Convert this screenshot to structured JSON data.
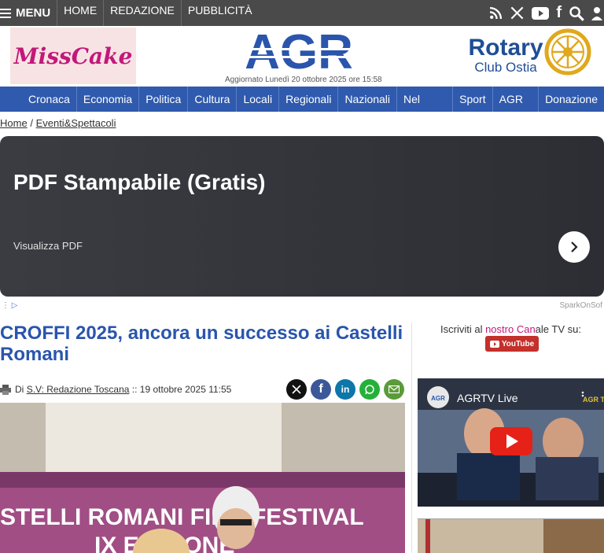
{
  "topbar": {
    "menu_label": "MENU",
    "links": [
      "HOME",
      "REDAZIONE",
      "PUBBLICITÀ"
    ],
    "icons": [
      "rss-icon",
      "x-icon",
      "youtube-icon",
      "facebook-icon",
      "search-icon",
      "user-icon"
    ]
  },
  "header": {
    "left_banner_text": "MissCake",
    "logo_text": "AGR",
    "updated_text": "Aggiornato Lunedì 20 ottobre 2025 ore 15:58",
    "rotary_line1": "Rotary",
    "rotary_line2": "Club Ostia"
  },
  "nav": {
    "items": [
      "Cronaca",
      "Economia",
      "Politica",
      "Cultura",
      "Locali",
      "Regionali",
      "Nazionali",
      "Nel Mondo",
      "Sport",
      "AGR TV",
      "Donazione"
    ]
  },
  "breadcrumb": {
    "home": "Home",
    "separator": "/",
    "section": "Eventi&Spettacoli"
  },
  "ad": {
    "title": "PDF Stampabile (Gratis)",
    "subtitle": "Visualizza PDF",
    "vendor": "SparkOnSof"
  },
  "article": {
    "title": "CROFFI 2025, ancora un successo ai Castelli Romani",
    "by_prefix": "Di",
    "author": "S.V: Redazione Toscana",
    "date": ":: 19 ottobre 2025 11:55",
    "photo_banner_text": "STELLI ROMANI FILM FESTIVAL",
    "photo_banner_text2": "IX EDIZIONE"
  },
  "sidebar": {
    "subscribe_prefix": "Iscriviti al ",
    "subscribe_link": "nostro Can",
    "subscribe_suffix": "ale TV su:",
    "youtube_label": "YouTube",
    "video_title": "AGRTV Live",
    "video_logo": "AGR TV"
  },
  "colors": {
    "topbar": "#4a4a4a",
    "nav": "#2f5aad",
    "title_blue": "#2a55ad",
    "youtube_red": "#c4302b"
  }
}
